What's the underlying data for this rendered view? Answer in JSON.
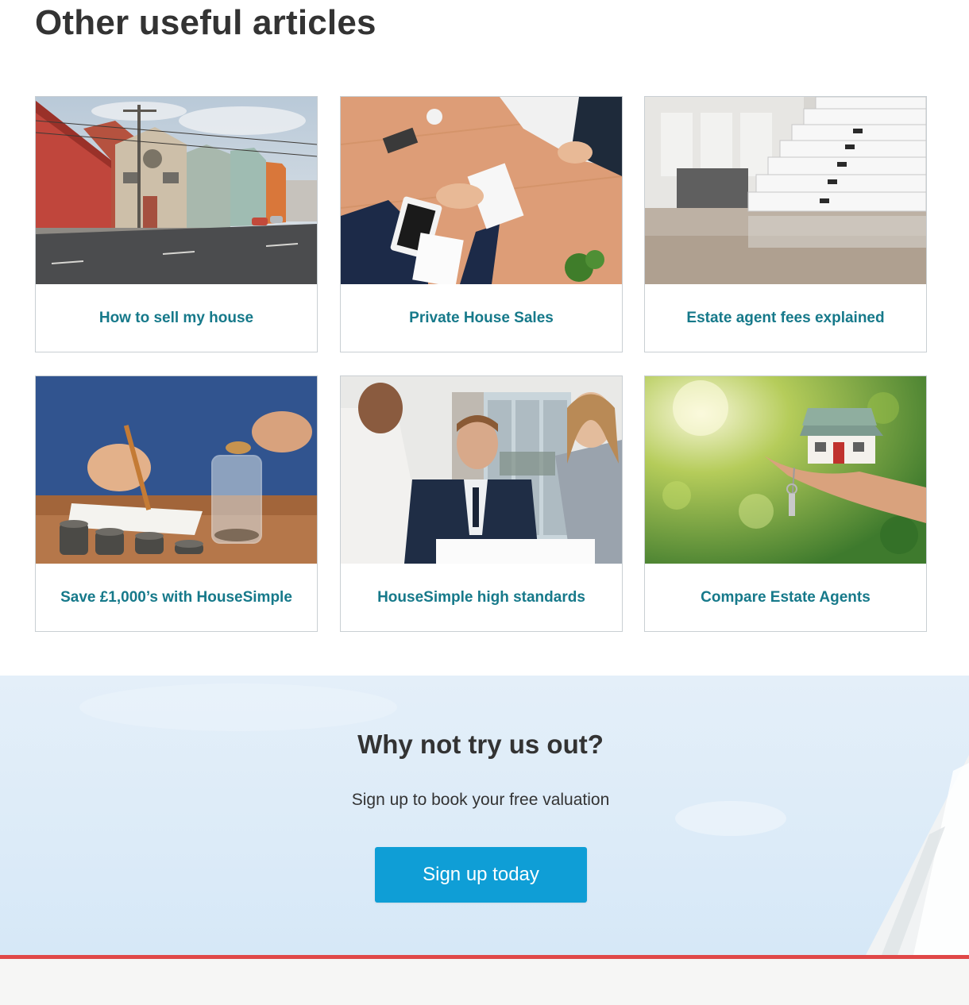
{
  "section": {
    "title": "Other useful articles"
  },
  "articles": [
    {
      "label": "How to sell my house",
      "image": "street-of-houses-photo"
    },
    {
      "label": "Private House Sales",
      "image": "handshake-over-desk-photo"
    },
    {
      "label": "Estate agent fees explained",
      "image": "stacks-of-paperwork-photo"
    },
    {
      "label": "Save £1,000’s with HouseSimple",
      "image": "coins-in-jar-photo"
    },
    {
      "label": "HouseSimple high standards",
      "image": "agent-meeting-photo"
    },
    {
      "label": "Compare Estate Agents",
      "image": "house-model-in-hand-photo"
    }
  ],
  "cta": {
    "heading": "Why not try us out?",
    "subtext": "Sign up to book your free valuation",
    "button_label": "Sign up today"
  },
  "colors": {
    "link_teal": "#16798a",
    "button_blue": "#0f9ed6",
    "cta_background": "#dcebf8",
    "accent_red": "#e04848",
    "footer_background": "#f6f6f5"
  }
}
